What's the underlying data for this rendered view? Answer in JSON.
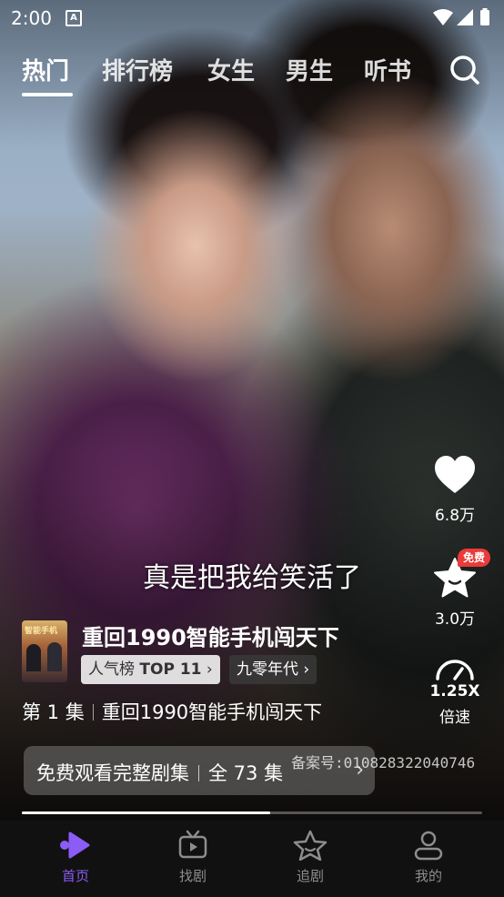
{
  "status_bar": {
    "time": "2:00",
    "notification_icon": "A"
  },
  "tabs": [
    {
      "label": "热门",
      "active": true
    },
    {
      "label": "排行榜",
      "active": false
    },
    {
      "label": "女生",
      "active": false
    },
    {
      "label": "男生",
      "active": false
    },
    {
      "label": "听书",
      "active": false
    }
  ],
  "rail": {
    "like_count": "6.8万",
    "collect_count": "3.0万",
    "free_badge": "免费",
    "speed_value": "1.25X",
    "speed_label": "倍速"
  },
  "subtitle": "真是把我给笑活了",
  "drama": {
    "poster_text": "智能手机",
    "title": "重回1990智能手机闯天下",
    "rank_prefix": "人气榜",
    "rank_value": "TOP 11",
    "genre": "九零年代",
    "episode_label": "第 1 集",
    "episode_title": "重回1990智能手机闯天下",
    "watch_label": "免费观看完整剧集",
    "total_label": "全 73 集",
    "record_no": "备案号:010828322040746",
    "progress": 0.54
  },
  "bottom_nav": [
    {
      "label": "首页",
      "icon": "play-icon",
      "active": true
    },
    {
      "label": "找剧",
      "icon": "tv-icon",
      "active": false
    },
    {
      "label": "追剧",
      "icon": "star-icon",
      "active": false
    },
    {
      "label": "我的",
      "icon": "person-icon",
      "active": false
    }
  ],
  "colors": {
    "accent": "#8b5cf6",
    "badge": "#ea3a3a"
  }
}
